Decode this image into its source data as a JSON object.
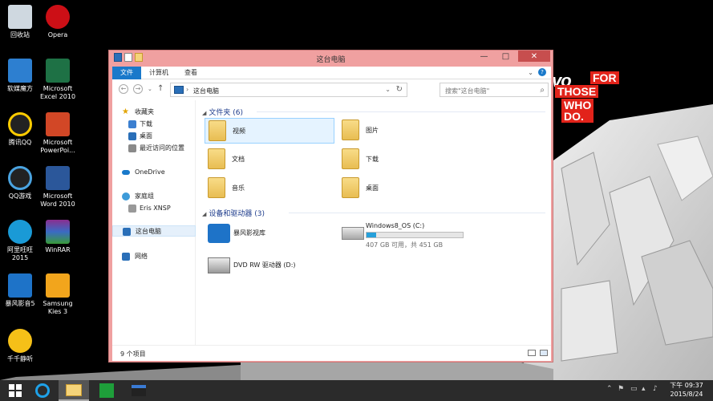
{
  "desktop": {
    "icons": [
      {
        "label": "回收站",
        "icon": "recycle-bin-icon"
      },
      {
        "label": "Opera",
        "icon": "opera-icon"
      },
      {
        "label": "软媒魔方",
        "icon": "ruanmei-icon"
      },
      {
        "label": "Microsoft Excel 2010",
        "icon": "excel-icon"
      },
      {
        "label": "腾讯QQ",
        "icon": "qq-icon"
      },
      {
        "label": "Microsoft PowerPoi...",
        "icon": "powerpoint-icon"
      },
      {
        "label": "QQ游戏",
        "icon": "qq-game-icon"
      },
      {
        "label": "Microsoft Word 2010",
        "icon": "word-icon"
      },
      {
        "label": "阿里旺旺 2015",
        "icon": "aliwangwang-icon"
      },
      {
        "label": "WinRAR",
        "icon": "winrar-icon"
      },
      {
        "label": "暴风影音5",
        "icon": "baofeng-icon"
      },
      {
        "label": "Samsung Kies 3",
        "icon": "kies-icon"
      },
      {
        "label": "千千静听",
        "icon": "ttplayer-icon"
      }
    ],
    "brand": {
      "partial": "vo",
      "line1": "FOR",
      "line2": "THOSE",
      "line3": "WHO DO.",
      "color": "#e2231a"
    }
  },
  "window": {
    "title": "这台电脑",
    "ribbon_tabs": [
      "文件",
      "计算机",
      "查看"
    ],
    "breadcrumb": "这台电脑",
    "search_placeholder": "搜索\"这台电脑\"",
    "nav": {
      "favorites": "收藏夹",
      "fav_items": [
        "下载",
        "桌面",
        "最近访问的位置"
      ],
      "onedrive": "OneDrive",
      "homegroup": "家庭组",
      "homegroup_user": "Eris XNSP",
      "thispc": "这台电脑",
      "network": "网络"
    },
    "folders_header": "文件夹 (6)",
    "folders": [
      {
        "name": "视频"
      },
      {
        "name": "图片"
      },
      {
        "name": "文档"
      },
      {
        "name": "下载"
      },
      {
        "name": "音乐"
      },
      {
        "name": "桌面"
      }
    ],
    "devices_header": "设备和驱动器 (3)",
    "devices": {
      "baofeng": "暴风影视库",
      "drive_c_name": "Windows8_OS (C:)",
      "drive_c_free": "407 GB 可用，共 451 GB",
      "drive_c_used_fraction": 0.1,
      "dvd": "DVD RW 驱动器 (D:)"
    },
    "status": "9 个项目"
  },
  "taskbar": {
    "clock_time": "下午 09:37",
    "clock_date": "2015/8/24"
  },
  "colors": {
    "accent": "#1979ca",
    "window_frame": "#f0a0a0",
    "close": "#c74e4e"
  }
}
